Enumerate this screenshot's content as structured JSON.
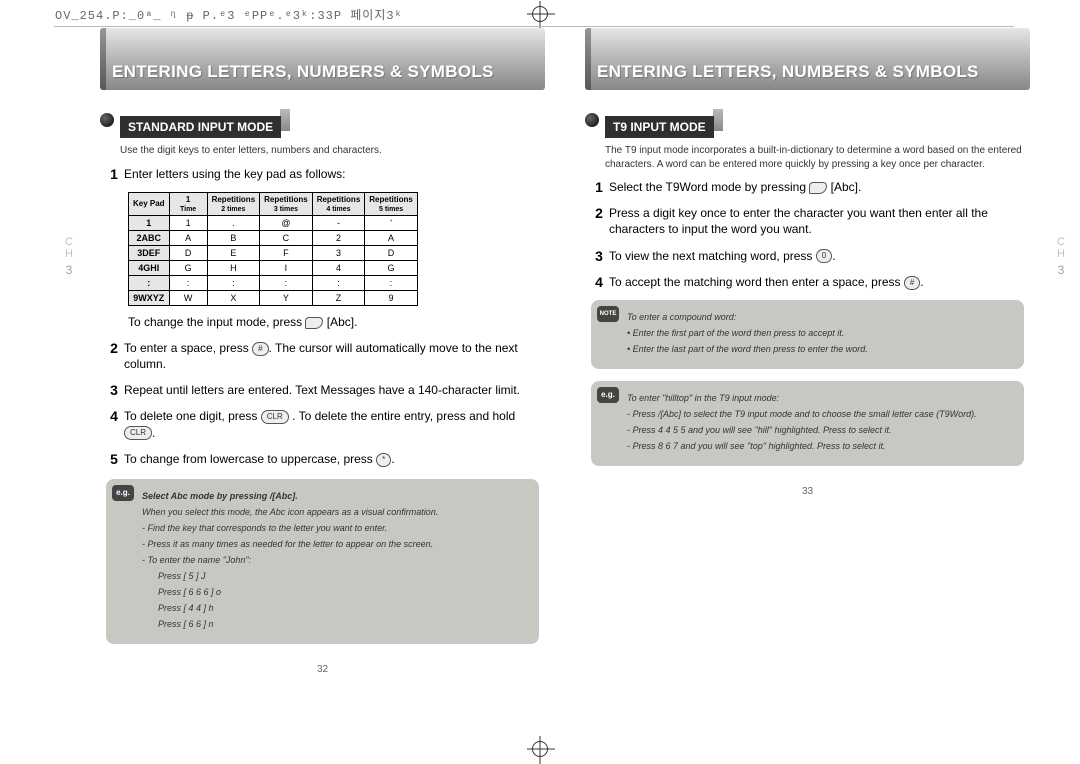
{
  "topbar": "OV_254.P:_0ᵃ_ ᶯ ᵽ P.ᵉ3  ᵉPPᵉ.ᵉ3ᵏ:33P  페이지3ᵏ",
  "header": "ENTERING LETTERS, NUMBERS & SYMBOLS",
  "left": {
    "section": "STANDARD INPUT MODE",
    "intro": "Use the digit keys to enter letters, numbers and characters.",
    "step1": "Enter letters using the key pad as follows:",
    "step1b": "To change the input mode, press ",
    "step1b_after": "[Abc].",
    "step2a": "To enter a space, press ",
    "step2b": ". The cursor will automatically move to the next column.",
    "step3": "Repeat until letters are entered. Text Messages have a 140-character limit.",
    "step4a": "To delete one digit, press ",
    "step4b": " . To delete the entire entry, press and hold ",
    "step4c": ".",
    "step5a": "To change from lowercase to uppercase, press ",
    "step5b": ".",
    "table": {
      "head": [
        "Key Pad",
        "1\nTime",
        "Repetitions\n2 times",
        "Repetitions\n3 times",
        "Repetitions\n4 times",
        "Repetitions\n5 times"
      ],
      "rows": [
        [
          "1",
          "1",
          ".",
          "@",
          "-",
          "'"
        ],
        [
          "2ABC",
          "A",
          "B",
          "C",
          "2",
          "A"
        ],
        [
          "3DEF",
          "D",
          "E",
          "F",
          "3",
          "D"
        ],
        [
          "4GHI",
          "G",
          "H",
          "I",
          "4",
          "G"
        ],
        [
          ":",
          ":",
          ":",
          ":",
          ":",
          ":"
        ],
        [
          "9WXYZ",
          "W",
          "X",
          "Y",
          "Z",
          "9"
        ]
      ]
    },
    "callout": {
      "badge": "e.g.",
      "title": "Select Abc mode by pressing       /[Abc].",
      "l1": "When you select this mode, the Abc icon appears as a visual confirmation.",
      "l2": "- Find the key that corresponds to the letter you want to enter.",
      "l3": "- Press it as many times as needed for the letter to appear on the screen.",
      "l4": "- To enter the name \"John\":",
      "p1": "Press [ 5 ]                                   J",
      "p2": "Press [ 6  6  6 ]                         o",
      "p3": "Press [ 4  4 ]                               h",
      "p4": "Press [ 6  6 ]                               n"
    },
    "pagenum": "32"
  },
  "right": {
    "section": "T9 INPUT MODE",
    "intro": "The T9 input mode incorporates a built-in-dictionary to determine a word based on the entered characters. A word can be entered more quickly by pressing a key once per character.",
    "step1a": "Select the T9Word mode by pressing ",
    "step1b": "[Abc].",
    "step2": "Press a digit key once to enter the character you want then enter all the characters to input the word you want.",
    "step3a": "To view the next matching word, press ",
    "step3b": ".",
    "step4a": "To accept the matching word then enter a space, press ",
    "step4b": ".",
    "note": {
      "badge": "NOTE",
      "l1": "To enter a compound word:",
      "l2": "•  Enter the first part of the word then press      to accept it.",
      "l3": "•  Enter the last part of the word then press      to enter the word."
    },
    "eg": {
      "badge": "e.g.",
      "l1": "To enter \"hilltop\" in the T9 input mode:",
      "l2": "- Press       /[Abc] to select the T9 input mode and       to choose the small letter case (T9Word).",
      "l3": "- Press 4  4  5  5 and you will see \"hill\" highlighted. Press    to select it.",
      "l4": "- Press 8  6  7 and you will see \"top\" highlighted. Press    to select it."
    },
    "pagenum": "33"
  },
  "chapter": {
    "c": "C",
    "h": "H",
    "n": "3"
  }
}
